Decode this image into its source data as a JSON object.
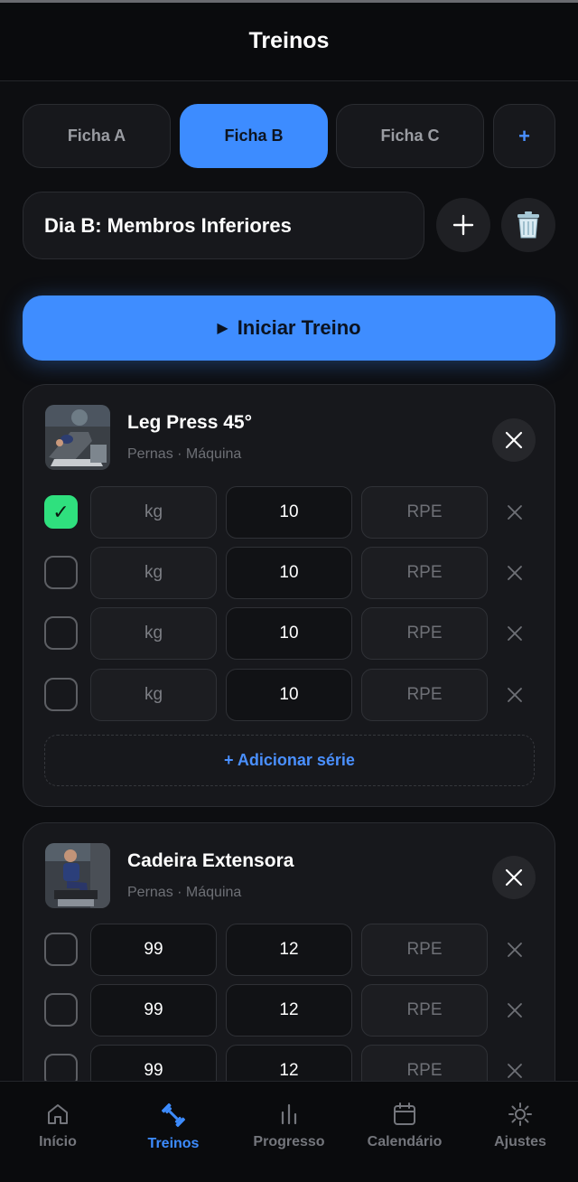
{
  "header": {
    "title": "Treinos"
  },
  "tabs": [
    {
      "label": "Ficha A",
      "active": false
    },
    {
      "label": "Ficha B",
      "active": true
    },
    {
      "label": "Ficha C",
      "active": false
    }
  ],
  "add_tab_label": "+",
  "day": {
    "name": "Dia B: Membros Inferiores",
    "add_icon": "plus-icon",
    "delete_icon": "trash-icon"
  },
  "start_button": {
    "icon": "▶",
    "label": "Iniciar Treino"
  },
  "exercises": [
    {
      "name": "Leg Press 45°",
      "subtitle": "Pernas · Máquina",
      "sets": [
        {
          "done": true,
          "weight": "kg",
          "reps": "10",
          "rpe": "RPE"
        },
        {
          "done": false,
          "weight": "kg",
          "reps": "10",
          "rpe": "RPE"
        },
        {
          "done": false,
          "weight": "kg",
          "reps": "10",
          "rpe": "RPE"
        },
        {
          "done": false,
          "weight": "kg",
          "reps": "10",
          "rpe": "RPE"
        }
      ],
      "add_series_label": "+ Adicionar série"
    },
    {
      "name": "Cadeira Extensora",
      "subtitle": "Pernas · Máquina",
      "sets": [
        {
          "done": false,
          "weight": "99",
          "reps": "12",
          "rpe": "RPE"
        },
        {
          "done": false,
          "weight": "99",
          "reps": "12",
          "rpe": "RPE"
        },
        {
          "done": false,
          "weight": "99",
          "reps": "12",
          "rpe": "RPE"
        }
      ]
    }
  ],
  "check_mark": "✓",
  "nav": [
    {
      "label": "Início",
      "icon": "home-icon",
      "active": false
    },
    {
      "label": "Treinos",
      "icon": "dumbbell-icon",
      "active": true
    },
    {
      "label": "Progresso",
      "icon": "bar-chart-icon",
      "active": false
    },
    {
      "label": "Calendário",
      "icon": "calendar-icon",
      "active": false
    },
    {
      "label": "Ajustes",
      "icon": "gear-icon",
      "active": false
    }
  ],
  "colors": {
    "accent": "#3d8cff",
    "done": "#2fe07e",
    "background": "#0d0e11"
  }
}
